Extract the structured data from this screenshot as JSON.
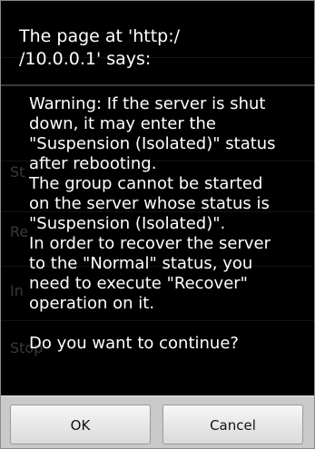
{
  "dialog": {
    "title": "The page at 'http:/\n/10.0.0.1' says:",
    "message": "Warning: If the server is shut\ndown, it may enter the\n\"Suspension (Isolated)\" status\nafter rebooting.\nThe group cannot be started\non the server whose status is\n\"Suspension (Isolated)\".\nIn order to recover the server\nto the \"Normal\" status, you\nneed to execute \"Recover\"\noperation on it.\n\nDo you want to continue?",
    "buttons": {
      "ok_label": "OK",
      "cancel_label": "Cancel"
    }
  },
  "background": {
    "partial_labels": [
      "St",
      "Re",
      "In",
      "Stop"
    ]
  },
  "colors": {
    "dialog_background": "#000000",
    "text": "#ffffff",
    "button_bar": "#c9c9c9",
    "button_face": "#ececec"
  }
}
